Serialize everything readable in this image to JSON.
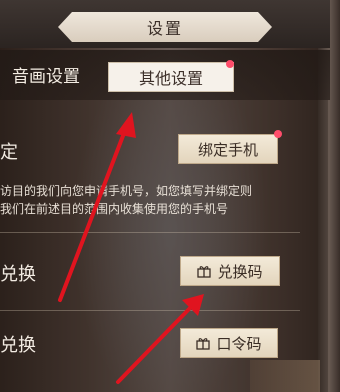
{
  "header": {
    "title": "设置"
  },
  "tabs": [
    {
      "label": "音画设置"
    },
    {
      "label": "其他设置"
    }
  ],
  "bind_phone": {
    "label": "定",
    "button": "绑定手机",
    "description_line1": "访目的我们向您申请手机号，如您填写并绑定则",
    "description_line2": "我们在前述目的范围内收集使用您的手机号"
  },
  "redeem_code": {
    "label": "兑换",
    "button": "兑换码"
  },
  "password_code": {
    "label": "兑换",
    "button": "口令码"
  },
  "icons": [
    "gift-icon",
    "gift-icon"
  ],
  "colors": {
    "badge": "#ff4d6b",
    "arrow": "#e0141f",
    "button_bg": "#efe4d0"
  }
}
